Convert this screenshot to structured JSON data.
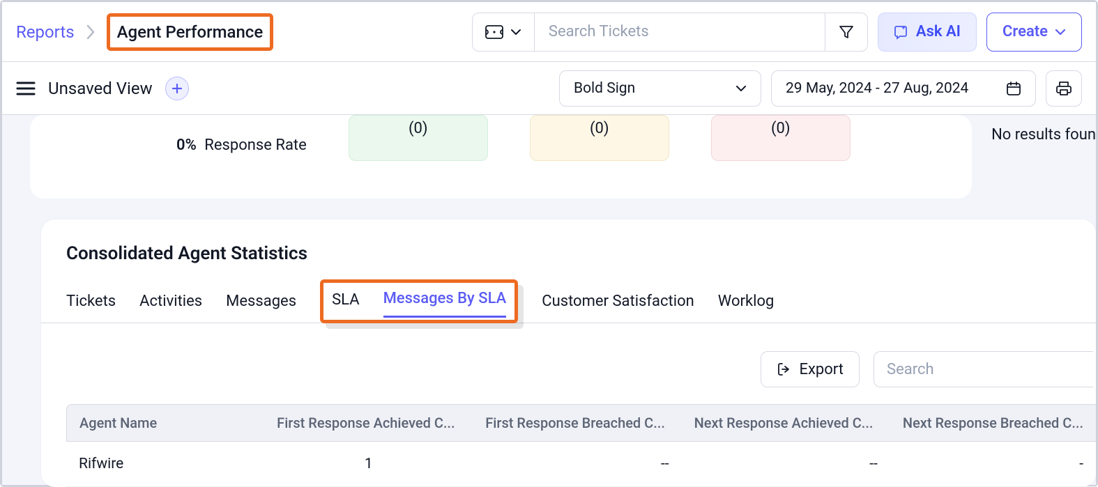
{
  "breadcrumb": {
    "root": "Reports",
    "page": "Agent Performance"
  },
  "topbar": {
    "search_placeholder": "Search Tickets",
    "ask_ai_label": "Ask AI",
    "create_label": "Create"
  },
  "subbar": {
    "view_title": "Unsaved View",
    "brand_selected": "Bold Sign",
    "date_range": "29 May, 2024 - 27 Aug, 2024"
  },
  "metrics": {
    "response_rate_value": "0%",
    "response_rate_label": "Response Rate",
    "stat1": "(0)",
    "stat2": "(0)",
    "stat3": "(0)",
    "side_note": "No results foun"
  },
  "stats": {
    "title": "Consolidated Agent Statistics",
    "tabs": [
      "Tickets",
      "Activities",
      "Messages",
      "SLA",
      "Messages By SLA",
      "Customer Satisfaction",
      "Worklog"
    ],
    "active_tab_index": 4,
    "export_label": "Export",
    "table_search_placeholder": "Search",
    "columns": [
      "Agent Name",
      "First Response Achieved C...",
      "First Response Breached C...",
      "Next Response Achieved C...",
      "Next Response Breached C..."
    ],
    "rows": [
      {
        "agent": "Rifwire",
        "c1": "1",
        "c2": "--",
        "c3": "--",
        "c4": "-"
      }
    ]
  }
}
